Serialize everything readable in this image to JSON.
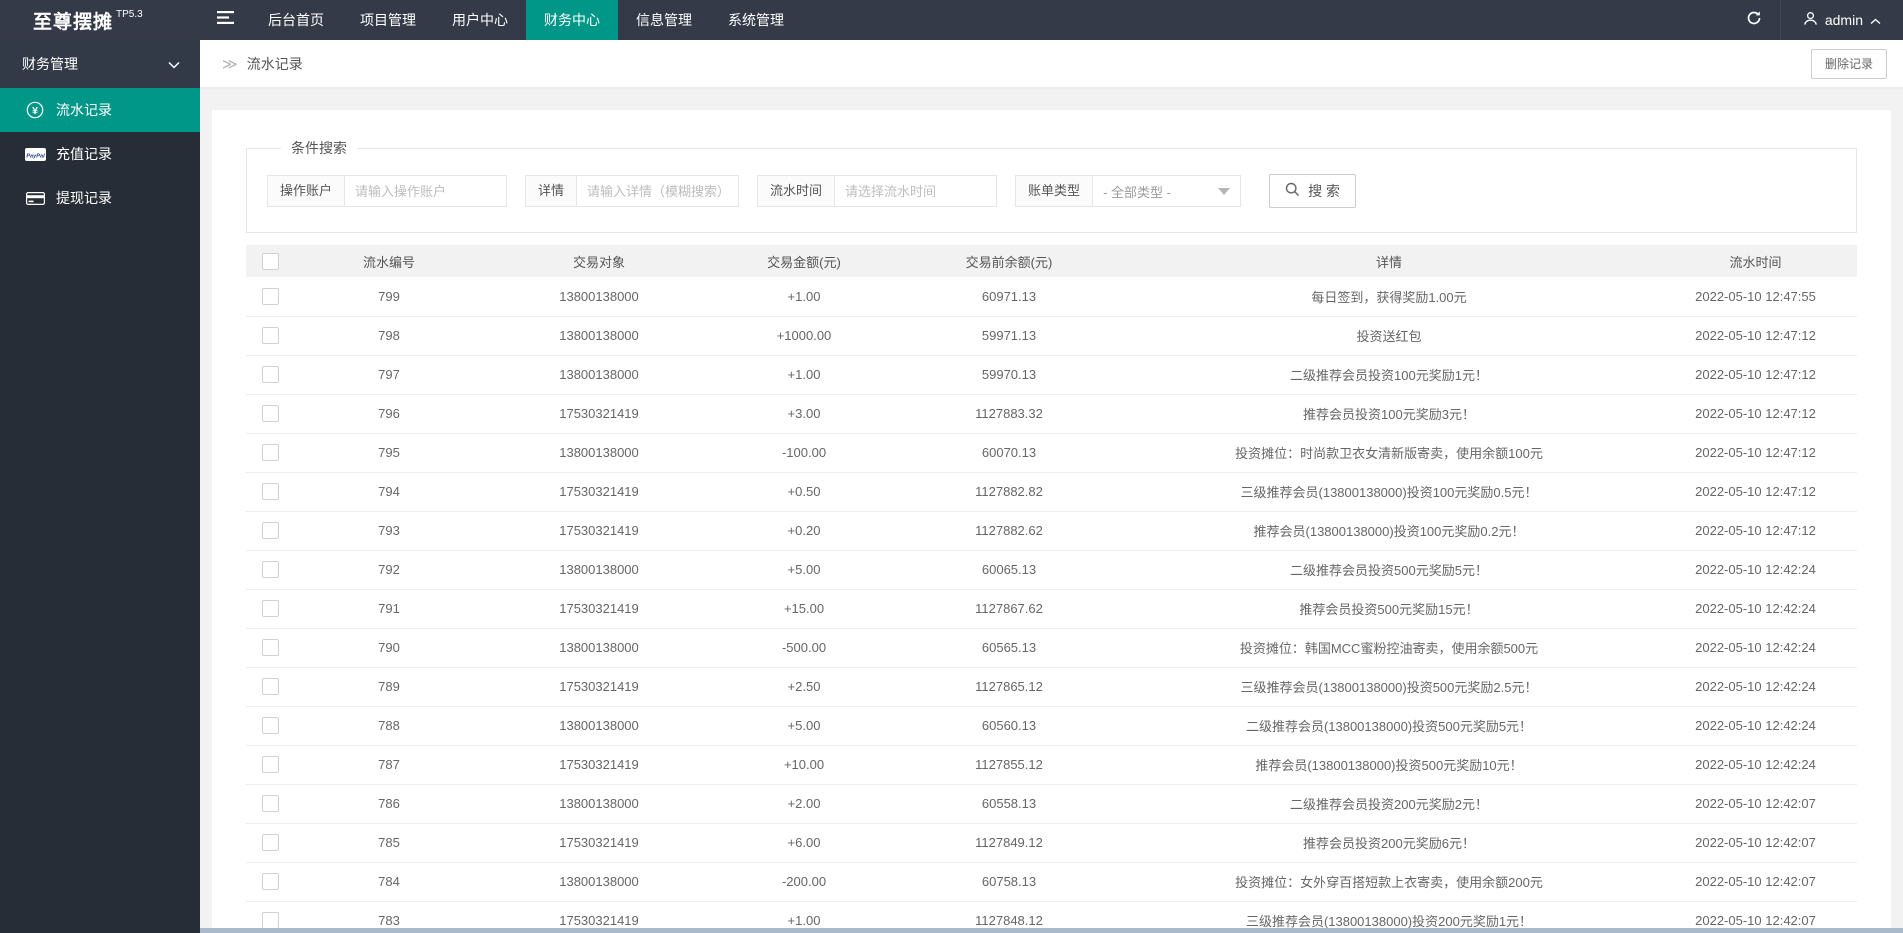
{
  "colors": {
    "accent": "#009688",
    "positive": "#00a600",
    "negative": "#ff4c4c",
    "topbar_bg": "#343a48",
    "sidebar_bg": "#272d37"
  },
  "topbar": {
    "logo": "至尊摆摊",
    "logo_version": "TP5.3",
    "menu": [
      {
        "label": "后台首页",
        "active": false
      },
      {
        "label": "项目管理",
        "active": false
      },
      {
        "label": "用户中心",
        "active": false
      },
      {
        "label": "财务中心",
        "active": true
      },
      {
        "label": "信息管理",
        "active": false
      },
      {
        "label": "系统管理",
        "active": false
      }
    ],
    "username": "admin"
  },
  "sidebar": {
    "group": "财务管理",
    "items": [
      {
        "label": "流水记录",
        "icon": "yen-circle-icon",
        "active": true
      },
      {
        "label": "充值记录",
        "icon": "paypal-icon",
        "active": false
      },
      {
        "label": "提现记录",
        "icon": "credit-card-icon",
        "active": false
      }
    ]
  },
  "breadcrumb": {
    "icon": "≫",
    "title": "流水记录",
    "delete_button": "删除记录"
  },
  "search": {
    "legend": "条件搜索",
    "fields": [
      {
        "label": "操作账户",
        "placeholder": "请输入操作账户"
      },
      {
        "label": "详情",
        "placeholder": "请输入详情（模糊搜索）"
      },
      {
        "label": "流水时间",
        "placeholder": "请选择流水时间"
      }
    ],
    "select": {
      "label": "账单类型",
      "value": "- 全部类型 -"
    },
    "search_button": "搜 索"
  },
  "table": {
    "columns": [
      "流水编号",
      "交易对象",
      "交易金额(元)",
      "交易前余额(元)",
      "详情",
      "流水时间"
    ],
    "rows": [
      [
        "799",
        "13800138000",
        "+1.00",
        "60971.13",
        "每日签到，获得奖励1.00元",
        "2022-05-10 12:47:55"
      ],
      [
        "798",
        "13800138000",
        "+1000.00",
        "59971.13",
        "投资送红包",
        "2022-05-10 12:47:12"
      ],
      [
        "797",
        "13800138000",
        "+1.00",
        "59970.13",
        "二级推荐会员投资100元奖励1元！",
        "2022-05-10 12:47:12"
      ],
      [
        "796",
        "17530321419",
        "+3.00",
        "1127883.32",
        "推荐会员投资100元奖励3元！",
        "2022-05-10 12:47:12"
      ],
      [
        "795",
        "13800138000",
        "-100.00",
        "60070.13",
        "投资摊位：时尚款卫衣女清新版寄卖，使用余额100元",
        "2022-05-10 12:47:12"
      ],
      [
        "794",
        "17530321419",
        "+0.50",
        "1127882.82",
        "三级推荐会员(13800138000)投资100元奖励0.5元！",
        "2022-05-10 12:47:12"
      ],
      [
        "793",
        "17530321419",
        "+0.20",
        "1127882.62",
        "推荐会员(13800138000)投资100元奖励0.2元！",
        "2022-05-10 12:47:12"
      ],
      [
        "792",
        "13800138000",
        "+5.00",
        "60065.13",
        "二级推荐会员投资500元奖励5元！",
        "2022-05-10 12:42:24"
      ],
      [
        "791",
        "17530321419",
        "+15.00",
        "1127867.62",
        "推荐会员投资500元奖励15元！",
        "2022-05-10 12:42:24"
      ],
      [
        "790",
        "13800138000",
        "-500.00",
        "60565.13",
        "投资摊位：韩国MCC蜜粉控油寄卖，使用余额500元",
        "2022-05-10 12:42:24"
      ],
      [
        "789",
        "17530321419",
        "+2.50",
        "1127865.12",
        "三级推荐会员(13800138000)投资500元奖励2.5元！",
        "2022-05-10 12:42:24"
      ],
      [
        "788",
        "13800138000",
        "+5.00",
        "60560.13",
        "二级推荐会员(13800138000)投资500元奖励5元！",
        "2022-05-10 12:42:24"
      ],
      [
        "787",
        "17530321419",
        "+10.00",
        "1127855.12",
        "推荐会员(13800138000)投资500元奖励10元！",
        "2022-05-10 12:42:24"
      ],
      [
        "786",
        "13800138000",
        "+2.00",
        "60558.13",
        "二级推荐会员投资200元奖励2元！",
        "2022-05-10 12:42:07"
      ],
      [
        "785",
        "17530321419",
        "+6.00",
        "1127849.12",
        "推荐会员投资200元奖励6元！",
        "2022-05-10 12:42:07"
      ],
      [
        "784",
        "13800138000",
        "-200.00",
        "60758.13",
        "投资摊位：女外穿百搭短款上衣寄卖，使用余额200元",
        "2022-05-10 12:42:07"
      ],
      [
        "783",
        "17530321419",
        "+1.00",
        "1127848.12",
        "三级推荐会员(13800138000)投资200元奖励1元！",
        "2022-05-10 12:42:07"
      ]
    ]
  }
}
